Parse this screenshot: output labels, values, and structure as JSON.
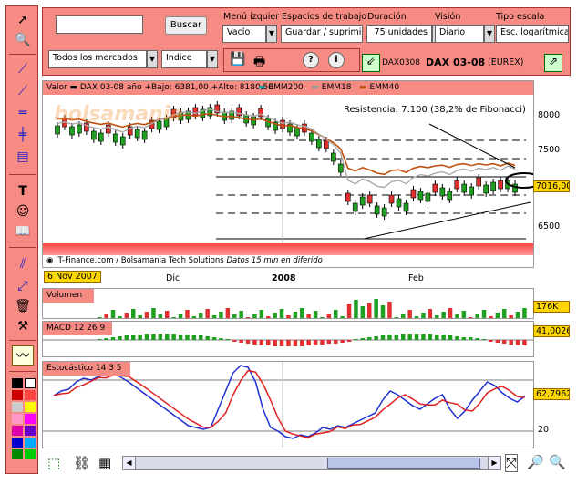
{
  "toolbar": {
    "search_placeholder": "",
    "search_button": "Buscar",
    "markets_select": "Todos los mercados",
    "type_select": "Indice",
    "menu_label": "Menú izquier",
    "menu_value": "Vacío",
    "spaces_label": "Espacios de trabajo",
    "spaces_value": "Guardar / suprimir",
    "duration_label": "Duración",
    "duration_value": "75 unidades",
    "view_label": "Visión",
    "view_value": "Diario",
    "scale_label": "Tipo escala",
    "scale_value": "Esc. logarítmica",
    "help_glyph": "?",
    "info_glyph": "i",
    "symbol_code": "DAX0308",
    "symbol_name": "DAX 03-08",
    "symbol_exchange": "(EUREX)"
  },
  "main_chart": {
    "header": "Valor  ▬ DAX 03-08   año +Bajo: 6381,00 +Alto: 8180,50",
    "legend": [
      {
        "name": "EMM200",
        "color": "#20a0a0"
      },
      {
        "name": "EMM18",
        "color": "#999999"
      },
      {
        "name": "EMM40",
        "color": "#c05010"
      }
    ],
    "watermark": "bolsamania",
    "annotation": "Resistencia: 7.100 (38,2% de Fibonacci)",
    "footer": "IT-Finance.com / Bolsamania Tech Solutions",
    "footer_note": "Datos 15 min en diferido",
    "y_ticks": [
      "8000",
      "7500",
      "7000",
      "6500"
    ],
    "last_value": "7016,00"
  },
  "date_axis": {
    "start": "6 Nov 2007",
    "labels": [
      "Dic",
      "2008",
      "Feb"
    ]
  },
  "volume": {
    "title": "Volumen",
    "last_value": "176K"
  },
  "macd": {
    "title": "MACD  12 26 9",
    "last_value": "41,0026"
  },
  "stoch": {
    "title": "Estocástico  14 3 5",
    "last_value": "62,7962",
    "y_ticks": [
      "20"
    ]
  },
  "colors": {
    "salmon": "#f58b83",
    "bull": "#209020",
    "bear": "#e03030",
    "blue": "#2030d0",
    "red": "#e02020"
  }
}
